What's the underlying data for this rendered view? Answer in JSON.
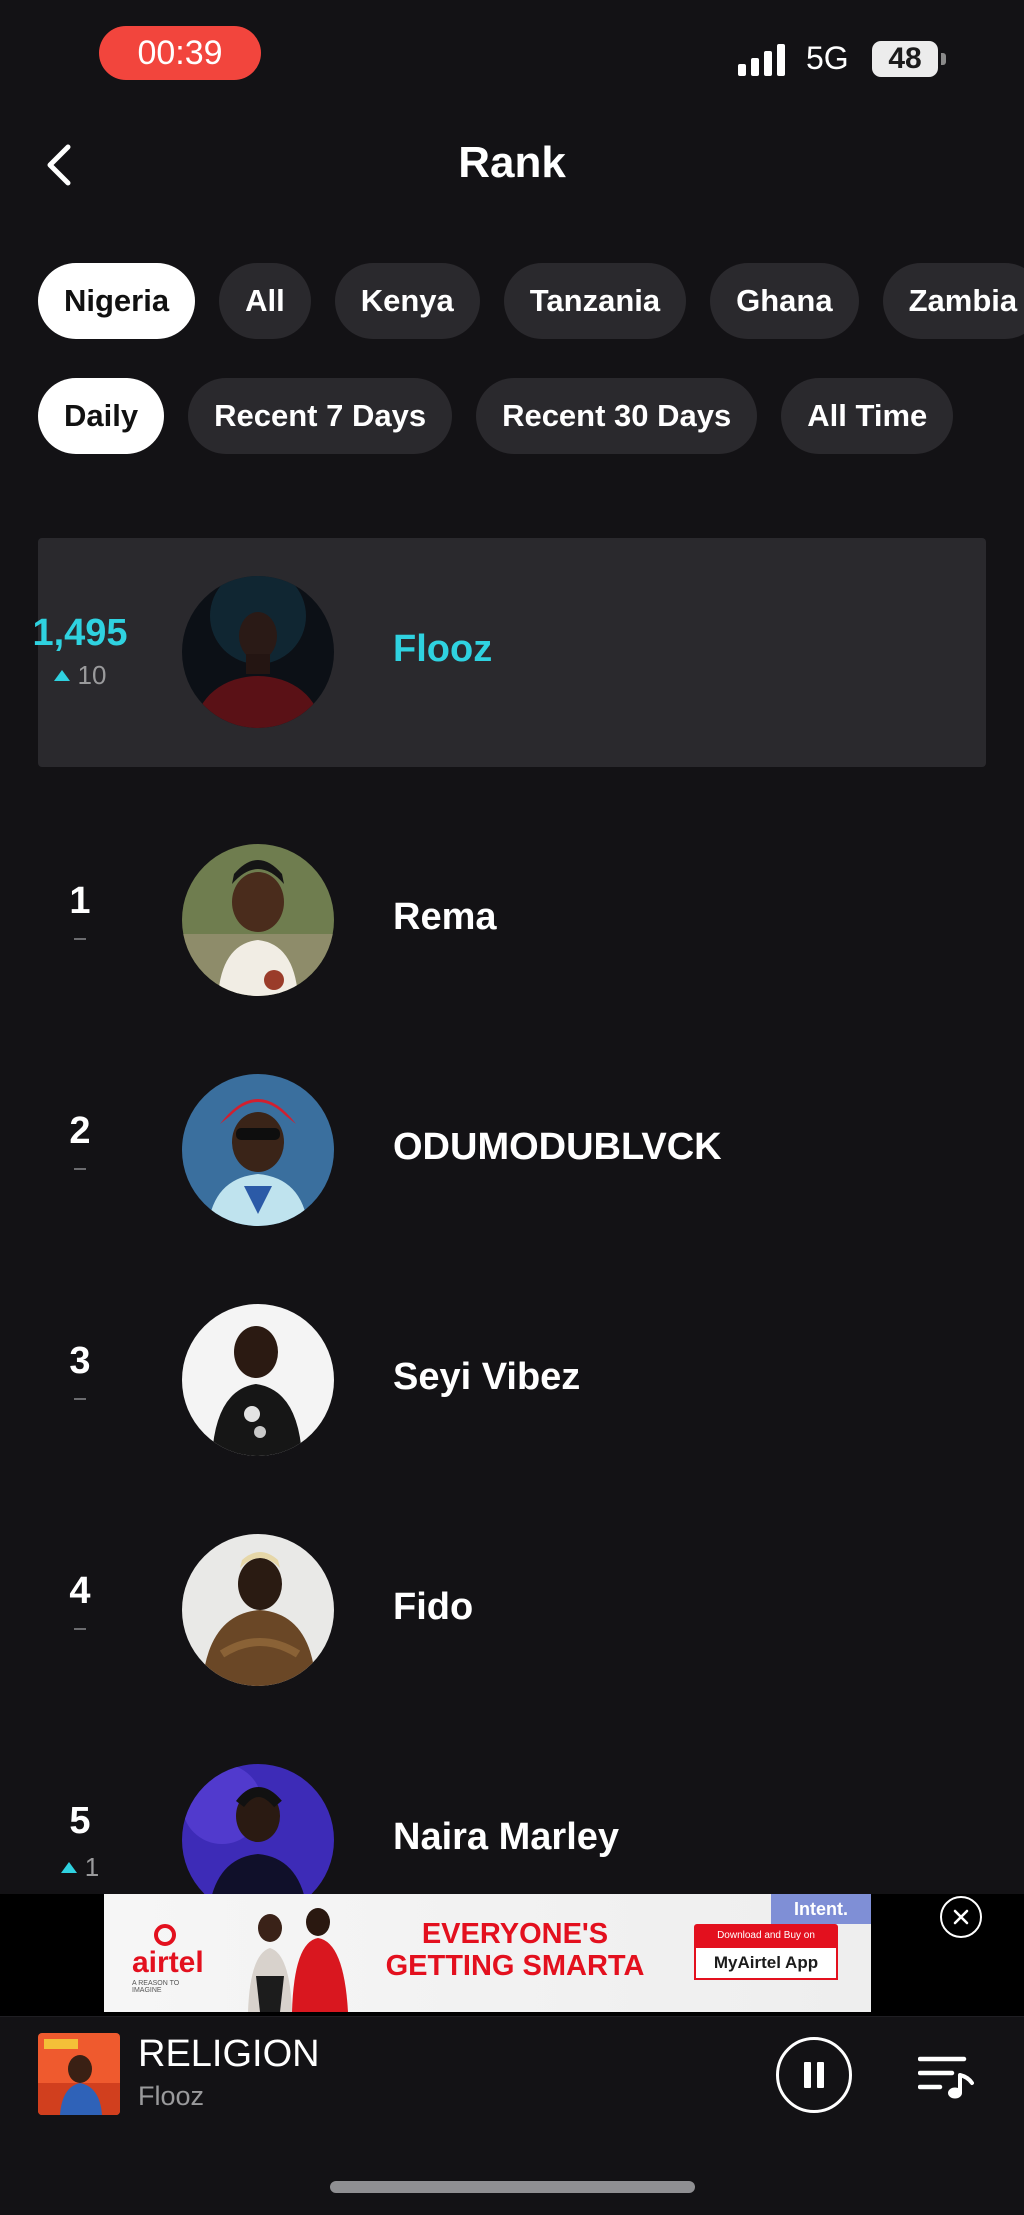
{
  "status_bar": {
    "time": "00:39",
    "network": "5G",
    "battery": "48"
  },
  "header": {
    "title": "Rank"
  },
  "region_tabs": [
    "Nigeria",
    "All",
    "Kenya",
    "Tanzania",
    "Ghana",
    "Zambia"
  ],
  "period_tabs": [
    "Daily",
    "Recent 7 Days",
    "Recent 30 Days",
    "All Time"
  ],
  "active_region": "Nigeria",
  "active_period": "Daily",
  "highlight": {
    "rank": "1,495",
    "change": "10",
    "artist": "Flooz"
  },
  "ranks": [
    {
      "rank": "1",
      "change": "",
      "artist": "Rema"
    },
    {
      "rank": "2",
      "change": "",
      "artist": "ODUMODUBLVCK"
    },
    {
      "rank": "3",
      "change": "",
      "artist": "Seyi Vibez"
    },
    {
      "rank": "4",
      "change": "",
      "artist": "Fido"
    },
    {
      "rank": "5",
      "change": "1",
      "artist": "Naira Marley"
    }
  ],
  "ad": {
    "sponsor_tag": "Intent.",
    "brand": "airtel",
    "brand_tagline": "A REASON TO IMAGINE",
    "headline_line1": "EVERYONE'S",
    "headline_line2": "GETTING SMARTA",
    "cta_top": "Download and Buy on",
    "cta_main": "MyAirtel App"
  },
  "now_playing": {
    "title": "RELIGION",
    "artist": "Flooz"
  },
  "colors": {
    "accent": "#2fd2e0",
    "background": "#131215",
    "chip": "#2a292d",
    "recording": "#f2453d",
    "ad_red": "#e3101e"
  }
}
